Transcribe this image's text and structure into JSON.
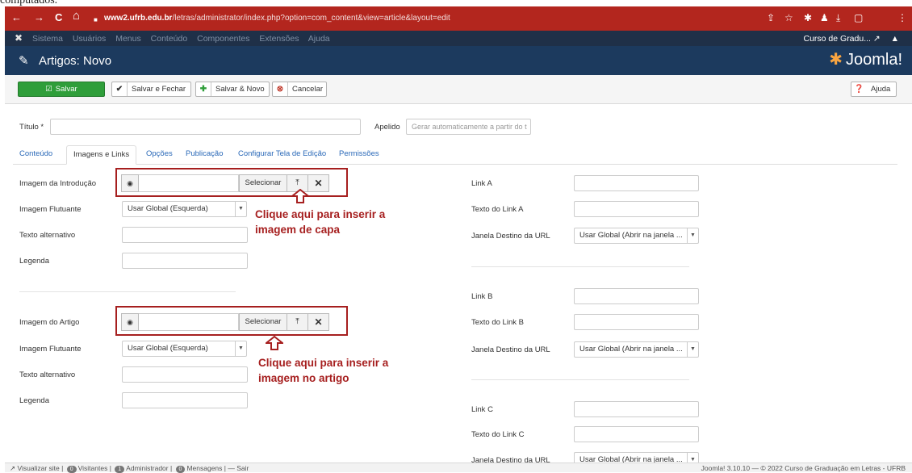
{
  "snippet_top": "computados.",
  "browser": {
    "url_domain": "www2.ufrb.edu.br",
    "url_path": "/letras/administrator/index.php?option=com_content&view=article&layout=edit",
    "back": "←",
    "forward": "→",
    "reload": "C",
    "home": "⌂",
    "lock": "🔒",
    "right_icons": [
      "⇪",
      "☆",
      "✱",
      "♟",
      "⤓",
      "▢",
      "⋮"
    ]
  },
  "joomla_nav": {
    "menu": [
      "Sistema",
      "Usuários",
      "Menus",
      "Conteúdo",
      "Componentes",
      "Extensões",
      "Ajuda"
    ],
    "site_name": "Curso de Gradu... ↗",
    "user_icon": "👤"
  },
  "header": {
    "title": "Artigos: Novo",
    "brand": "Joomla!"
  },
  "toolbar": {
    "save": "Salvar",
    "save_close": "Salvar e Fechar",
    "save_new": "Salvar & Novo",
    "cancel": "Cancelar",
    "help": "Ajuda"
  },
  "form": {
    "title_label": "Título *",
    "title_value": "",
    "alias_label": "Apelido",
    "alias_placeholder": "Gerar automaticamente a partir do t"
  },
  "tabs": [
    "Conteúdo",
    "Imagens e Links",
    "Opções",
    "Publicação",
    "Configurar Tela de Edição",
    "Permissões"
  ],
  "active_tab": "Imagens e Links",
  "intro": {
    "image_label": "Imagem da Introdução",
    "select": "Selecionar",
    "float_label": "Imagem Flutuante",
    "float_value": "Usar Global (Esquerda)",
    "alt_label": "Texto alternativo",
    "caption_label": "Legenda"
  },
  "full": {
    "image_label": "Imagem do Artigo",
    "select": "Selecionar",
    "float_label": "Imagem Flutuante",
    "float_value": "Usar Global (Esquerda)",
    "alt_label": "Texto alternativo",
    "caption_label": "Legenda"
  },
  "callouts": {
    "cover_1": "Clique aqui para inserir a",
    "cover_2": "imagem de capa",
    "article_1": "Clique aqui para inserir a",
    "article_2": "imagem no artigo"
  },
  "links": {
    "a_label": "Link A",
    "a_text_label": "Texto do Link A",
    "a_target_label": "Janela Destino da URL",
    "a_target_value": "Usar Global (Abrir na janela ...",
    "b_label": "Link B",
    "b_text_label": "Texto do Link B",
    "b_target_label": "Janela Destino da URL",
    "b_target_value": "Usar Global (Abrir na janela ...",
    "c_label": "Link C",
    "c_text_label": "Texto do Link C",
    "c_target_label": "Janela Destino da URL",
    "c_target_value": "Usar Global (Abrir na janela ..."
  },
  "status": {
    "view_site": "Visualizar site",
    "visitors_count": "0",
    "visitors": "Visitantes",
    "admin_count": "1",
    "admin": "Administrador",
    "messages_count": "0",
    "messages": "Mensagens",
    "logout": "Sair",
    "footer": "Joomla! 3.10.10 — © 2022 Curso de Graduação em Letras - UFRB"
  },
  "colors": {
    "browser_bar": "#b3261e",
    "joomla_nav": "#1f3048",
    "joomla_header": "#1c3a5e",
    "save_button": "#2f9e3a",
    "annotation": "#a61f1f"
  }
}
